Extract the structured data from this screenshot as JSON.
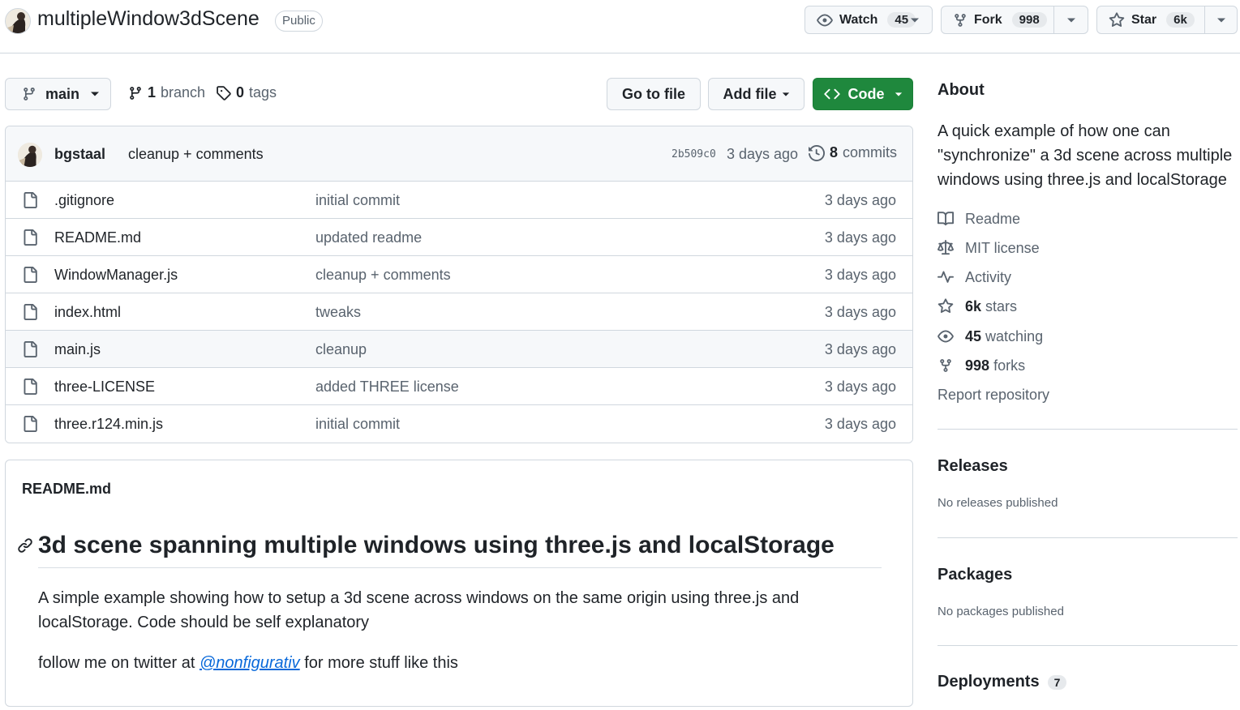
{
  "repo": {
    "name": "multipleWindow3dScene",
    "visibility": "Public",
    "owner_avatar_alt": "bgstaal"
  },
  "header_actions": {
    "watch": {
      "label": "Watch",
      "count": "45"
    },
    "fork": {
      "label": "Fork",
      "count": "998"
    },
    "star": {
      "label": "Star",
      "count": "6k"
    }
  },
  "branch_bar": {
    "current_branch": "main",
    "branch_count": "1",
    "branch_label": "branch",
    "tag_count": "0",
    "tag_label": "tags",
    "go_to_file": "Go to file",
    "add_file": "Add file",
    "code": "Code"
  },
  "latest_commit": {
    "author": "bgstaal",
    "message": "cleanup + comments",
    "sha": "2b509c0",
    "time": "3 days ago",
    "commit_count": "8",
    "commits_label": "commits"
  },
  "files": [
    {
      "name": ".gitignore",
      "message": "initial commit",
      "time": "3 days ago"
    },
    {
      "name": "README.md",
      "message": "updated readme",
      "time": "3 days ago"
    },
    {
      "name": "WindowManager.js",
      "message": "cleanup + comments",
      "time": "3 days ago"
    },
    {
      "name": "index.html",
      "message": "tweaks",
      "time": "3 days ago"
    },
    {
      "name": "main.js",
      "message": "cleanup",
      "time": "3 days ago"
    },
    {
      "name": "three-LICENSE",
      "message": "added THREE license",
      "time": "3 days ago"
    },
    {
      "name": "three.r124.min.js",
      "message": "initial commit",
      "time": "3 days ago"
    }
  ],
  "readme": {
    "tab": "README.md",
    "heading": "3d scene spanning multiple windows using three.js and localStorage",
    "paragraph1": "A simple example showing how to setup a 3d scene across windows on the same origin using three.js and localStorage. Code should be self explanatory",
    "paragraph2_before": "follow me on twitter at ",
    "twitter_handle": "@nonfigurativ",
    "paragraph2_after": " for more stuff like this"
  },
  "about": {
    "title": "About",
    "description": "A quick example of how one can \"synchronize\" a 3d scene across multiple windows using three.js and localStorage",
    "readme": "Readme",
    "license": "MIT license",
    "activity": "Activity",
    "stars_count": "6k",
    "stars_label": "stars",
    "watching_count": "45",
    "watching_label": "watching",
    "forks_count": "998",
    "forks_label": "forks",
    "report": "Report repository"
  },
  "releases": {
    "title": "Releases",
    "note": "No releases published"
  },
  "packages": {
    "title": "Packages",
    "note": "No packages published"
  },
  "deployments": {
    "title": "Deployments",
    "count": "7"
  },
  "colors": {
    "accent_green": "#1f883d",
    "link_blue": "#0969da",
    "muted_text": "#59636e",
    "border": "#d0d7de"
  }
}
